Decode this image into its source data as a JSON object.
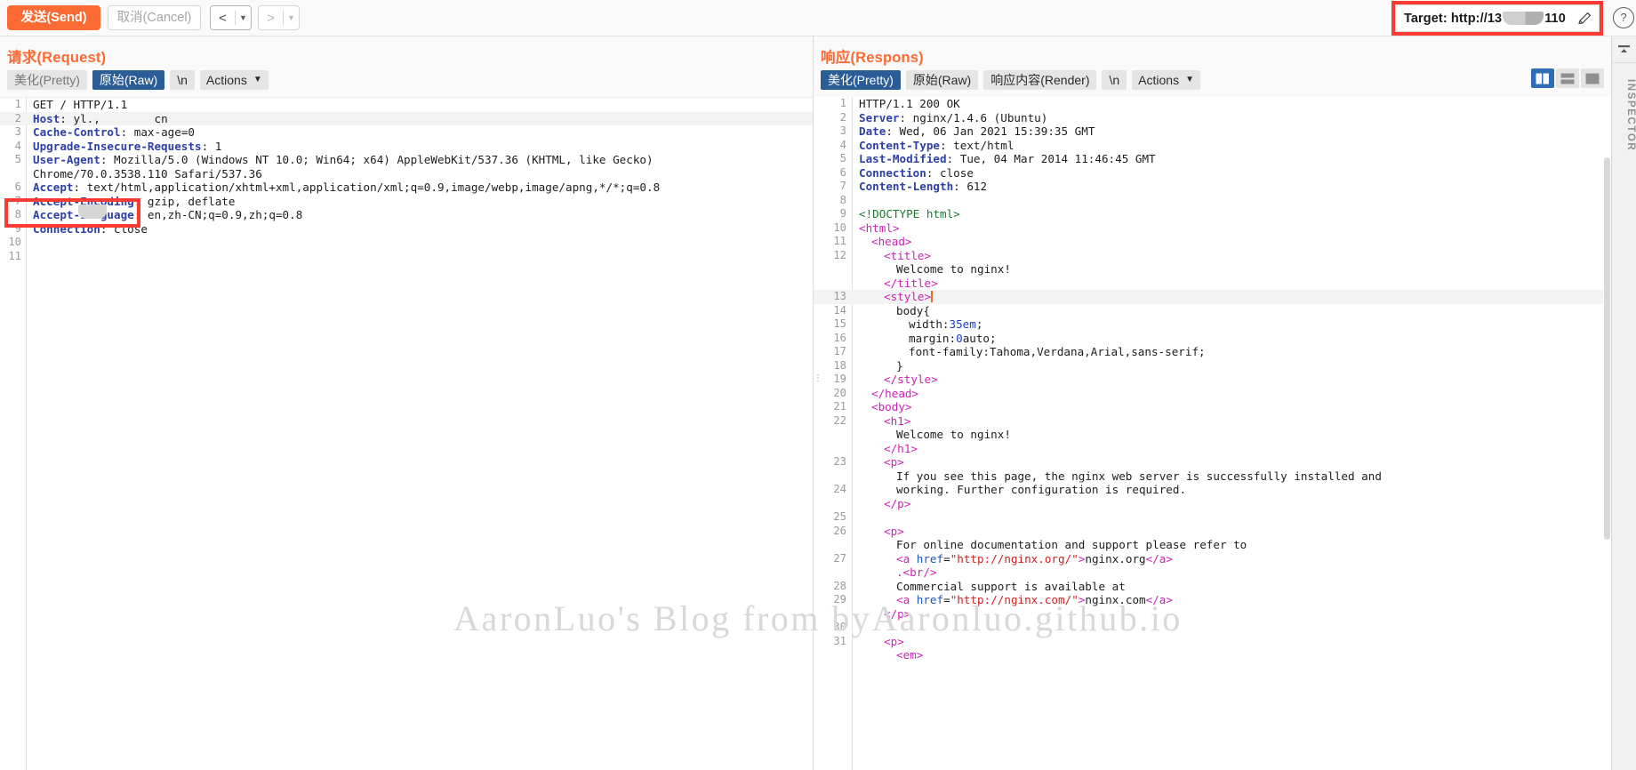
{
  "toolbar": {
    "send_label": "发送(Send)",
    "cancel_label": "取消(Cancel)",
    "prev_arrow": "<",
    "next_arrow": ">",
    "caret": "▼",
    "target_prefix": "Target: http://13",
    "target_suffix": "110",
    "pencil_icon": "pencil-icon",
    "help_icon": "?"
  },
  "request": {
    "title": "请求(Request)",
    "tabs": [
      {
        "label": "美化(Pretty)",
        "active": false
      },
      {
        "label": "原始(Raw)",
        "active": true
      },
      {
        "label": "\\n",
        "active": false
      }
    ],
    "actions_label": "Actions",
    "lines": [
      {
        "n": "1",
        "text": "GET / HTTP/1.1"
      },
      {
        "n": "2",
        "header": "Host",
        "value": "yl.,        cn"
      },
      {
        "n": "3",
        "header": "Cache-Control",
        "value": "max-age=0"
      },
      {
        "n": "4",
        "header": "Upgrade-Insecure-Requests",
        "value": "1"
      },
      {
        "n": "5",
        "header": "User-Agent",
        "value": "Mozilla/5.0 (Windows NT 10.0; Win64; x64) AppleWebKit/537.36 (KHTML, like Gecko)"
      },
      {
        "n": "",
        "text": "Chrome/70.0.3538.110 Safari/537.36"
      },
      {
        "n": "6",
        "header": "Accept",
        "value": "text/html,application/xhtml+xml,application/xml;q=0.9,image/webp,image/apng,*/*;q=0.8"
      },
      {
        "n": "7",
        "header": "Accept-Encoding",
        "value": "gzip, deflate"
      },
      {
        "n": "8",
        "header": "Accept-Language",
        "value": "en,zh-CN;q=0.9,zh;q=0.8"
      },
      {
        "n": "9",
        "header": "Connection",
        "value": "close"
      },
      {
        "n": "10",
        "text": ""
      },
      {
        "n": "11",
        "text": ""
      }
    ]
  },
  "response": {
    "title": "响应(Respons)",
    "tabs": [
      {
        "label": "美化(Pretty)",
        "active": true
      },
      {
        "label": "原始(Raw)",
        "active": false
      },
      {
        "label": "响应内容(Render)",
        "active": false
      },
      {
        "label": "\\n",
        "active": false
      }
    ],
    "actions_label": "Actions",
    "layout_buttons": [
      "split-vertical-icon",
      "split-horizontal-icon",
      "single-pane-icon"
    ],
    "headers": [
      {
        "n": "1",
        "status": "HTTP/1.1 200 OK"
      },
      {
        "n": "2",
        "header": "Server",
        "value": "nginx/1.4.6 (Ubuntu)"
      },
      {
        "n": "3",
        "header": "Date",
        "value": "Wed, 06 Jan 2021 15:39:35 GMT"
      },
      {
        "n": "4",
        "header": "Content-Type",
        "value": "text/html"
      },
      {
        "n": "5",
        "header": "Last-Modified",
        "value": "Tue, 04 Mar 2014 11:46:45 GMT"
      },
      {
        "n": "6",
        "header": "Connection",
        "value": "close"
      },
      {
        "n": "7",
        "header": "Content-Length",
        "value": "612"
      },
      {
        "n": "8",
        "blank": true
      }
    ],
    "body_lines": [
      {
        "n": "9",
        "kind": "doctype",
        "text": "<!DOCTYPE html>",
        "indent": 0
      },
      {
        "n": "10",
        "kind": "tag",
        "text": "<html>",
        "indent": 0
      },
      {
        "n": "11",
        "kind": "tag",
        "text": "<head>",
        "indent": 1
      },
      {
        "n": "12",
        "kind": "tag",
        "text": "<title>",
        "indent": 2
      },
      {
        "n": "",
        "kind": "text",
        "text": "Welcome to nginx!",
        "indent": 3
      },
      {
        "n": "",
        "kind": "tag",
        "text": "</title>",
        "indent": 2
      },
      {
        "n": "13",
        "kind": "tag-caret",
        "text": "<style>",
        "indent": 2,
        "highlight": true
      },
      {
        "n": "14",
        "kind": "css-sel",
        "text": "body{",
        "indent": 3
      },
      {
        "n": "15",
        "kind": "css-decl",
        "prop": "width",
        "value": "35em",
        "indent": 4
      },
      {
        "n": "16",
        "kind": "css-decl",
        "prop": "margin",
        "value": "0",
        "rest": "auto",
        "indent": 4
      },
      {
        "n": "17",
        "kind": "css-decl",
        "prop": "font-family",
        "value": "",
        "rest": "Tahoma,Verdana,Arial,sans-serif",
        "indent": 4
      },
      {
        "n": "18",
        "kind": "css-sel",
        "text": "}",
        "indent": 3
      },
      {
        "n": "19",
        "kind": "tag",
        "text": "</style>",
        "indent": 2,
        "fold": true
      },
      {
        "n": "20",
        "kind": "tag",
        "text": "</head>",
        "indent": 1
      },
      {
        "n": "21",
        "kind": "tag",
        "text": "<body>",
        "indent": 1
      },
      {
        "n": "22",
        "kind": "tag",
        "text": "<h1>",
        "indent": 2
      },
      {
        "n": "",
        "kind": "text",
        "text": "Welcome to nginx!",
        "indent": 3
      },
      {
        "n": "",
        "kind": "tag",
        "text": "</h1>",
        "indent": 2
      },
      {
        "n": "23",
        "kind": "tag",
        "text": "<p>",
        "indent": 2
      },
      {
        "n": "",
        "kind": "text",
        "text": "If you see this page, the nginx web server is successfully installed and",
        "indent": 3
      },
      {
        "n": "24",
        "kind": "text",
        "text": "working. Further configuration is required.",
        "indent": 3
      },
      {
        "n": "",
        "kind": "tag",
        "text": "</p>",
        "indent": 2
      },
      {
        "n": "25",
        "kind": "blank",
        "text": "",
        "indent": 0
      },
      {
        "n": "26",
        "kind": "tag",
        "text": "<p>",
        "indent": 2
      },
      {
        "n": "",
        "kind": "text",
        "text": "For online documentation and support please refer to",
        "indent": 3
      },
      {
        "n": "27",
        "kind": "anchor",
        "href": "http://nginx.org/",
        "label": "nginx.org",
        "indent": 3
      },
      {
        "n": "",
        "kind": "br",
        "text": ".<br/>",
        "indent": 3
      },
      {
        "n": "28",
        "kind": "text",
        "text": "Commercial support is available at",
        "indent": 3
      },
      {
        "n": "29",
        "kind": "anchor",
        "href": "http://nginx.com/",
        "label": "nginx.com",
        "indent": 3
      },
      {
        "n": "",
        "kind": "tag",
        "text": "</p>",
        "indent": 2
      },
      {
        "n": "30",
        "kind": "blank",
        "text": "",
        "indent": 0
      },
      {
        "n": "31",
        "kind": "tag",
        "text": "<p>",
        "indent": 2
      },
      {
        "n": "",
        "kind": "tag",
        "text": "<em>",
        "indent": 3
      }
    ]
  },
  "inspector": {
    "label": "INSPECTOR"
  },
  "watermark": {
    "text": "AaronLuo's Blog from byAaronluo.github.io"
  },
  "colors": {
    "accent_orange": "#fb6a33",
    "annotation_red": "#fb3b32",
    "tab_active_blue": "#2a5d95",
    "layout_active_blue": "#2f6eb5",
    "header_key": "#2d3fa8",
    "tag": "#cc22b6",
    "string": "#cc2222",
    "doctype": "#1d7a33"
  }
}
